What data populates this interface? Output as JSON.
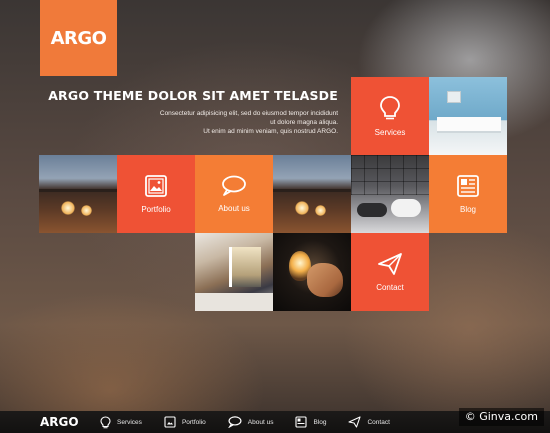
{
  "brand": {
    "logo": "ARGO"
  },
  "hero": {
    "title": "ARGO THEME DOLOR SIT AMET TELASDE",
    "line1": "Consectetur adipisicing elit, sed do eiusmod tempor incididunt",
    "line2": "ut dolore magna aliqua.",
    "line3": "Ut enim ad minim veniam, quis nostrud ARGO."
  },
  "tiles": {
    "services": {
      "label": "Services",
      "icon": "lightbulb-icon",
      "color": "#ef5235"
    },
    "portfolio": {
      "label": "Portfolio",
      "icon": "picture-icon",
      "color": "#ef5235"
    },
    "about": {
      "label": "About us",
      "icon": "speech-bubble-icon",
      "color": "#f47d35"
    },
    "blog": {
      "label": "Blog",
      "icon": "newspaper-icon",
      "color": "#f47d35"
    },
    "contact": {
      "label": "Contact",
      "icon": "paper-plane-icon",
      "color": "#ef5235"
    }
  },
  "bottom_nav": {
    "brand": "ARGO",
    "items": [
      {
        "label": "Services",
        "icon": "lightbulb-icon"
      },
      {
        "label": "Portfolio",
        "icon": "picture-icon"
      },
      {
        "label": "About us",
        "icon": "speech-bubble-icon"
      },
      {
        "label": "Blog",
        "icon": "newspaper-icon"
      },
      {
        "label": "Contact",
        "icon": "paper-plane-icon"
      }
    ]
  },
  "watermark": "© Ginva.com"
}
